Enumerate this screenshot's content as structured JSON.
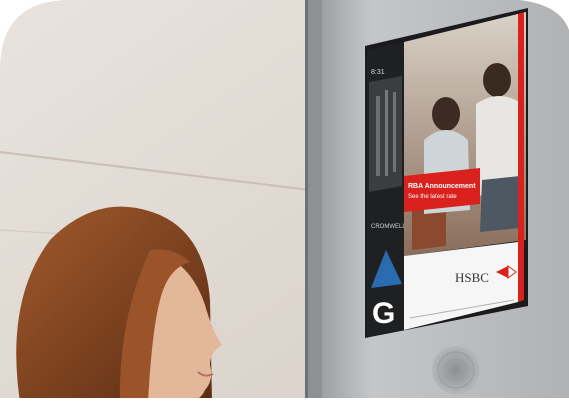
{
  "screen": {
    "top_label": "8:31",
    "floor_letter": "G",
    "ad_banner_title": "RBA Announcement",
    "ad_banner_subtitle": "See the latest rate",
    "sponsor_logo": "HSBC",
    "small_logo_text": "CROMWELL"
  },
  "colors": {
    "wall": "#ddd6cf",
    "panel": "#b7b9bb",
    "ad_red": "#d9221d",
    "arrow_blue": "#2b6bb0",
    "hair": "#7a3f22"
  }
}
